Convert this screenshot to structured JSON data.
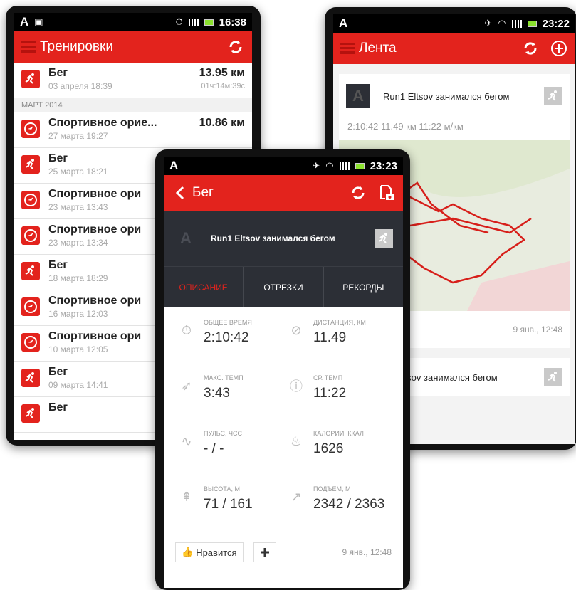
{
  "colors": {
    "accent": "#e3231d",
    "dark": "#2c2f36"
  },
  "list_phone": {
    "status": {
      "time": "16:38"
    },
    "title": "Тренировки",
    "first": {
      "title": "Бег",
      "date": "03 апреля 18:39",
      "distance": "13.95 км",
      "duration": "01ч:14м:39с"
    },
    "section": "МАРТ 2014",
    "items": [
      {
        "icon": "orienteering-icon",
        "title": "Спортивное орие...",
        "date": "27 марта 19:27",
        "distance": "10.86 км"
      },
      {
        "icon": "running-icon",
        "title": "Бег",
        "date": "25 марта 18:21"
      },
      {
        "icon": "orienteering-icon",
        "title": "Спортивное ори",
        "date": "23 марта 13:43"
      },
      {
        "icon": "orienteering-icon",
        "title": "Спортивное ори",
        "date": "23 марта 13:34"
      },
      {
        "icon": "running-icon",
        "title": "Бег",
        "date": "18 марта 18:29"
      },
      {
        "icon": "orienteering-icon",
        "title": "Спортивное ори",
        "date": "16 марта 12:03"
      },
      {
        "icon": "orienteering-icon",
        "title": "Спортивное ори",
        "date": "10 марта 12:05"
      },
      {
        "icon": "running-icon",
        "title": "Бег",
        "date": "09 марта 14:41"
      },
      {
        "icon": "running-icon",
        "title": "Бег",
        "date": ""
      }
    ]
  },
  "feed_phone": {
    "status": {
      "time": "23:22"
    },
    "title": "Лента",
    "card": {
      "avatar": "A",
      "title": "Run1 Eltsov занимался бегом",
      "stats": "2:10:42   11.49 км   11:22 м/км",
      "date": "9 янв., 12:48"
    },
    "card2_title": "Eltsov занимался бегом"
  },
  "detail_phone": {
    "status": {
      "time": "23:23"
    },
    "title": "Бег",
    "avatar": "A",
    "header": "Run1 Eltsov занимался бегом",
    "tabs": [
      "ОПИСАНИЕ",
      "ОТРЕЗКИ",
      "РЕКОРДЫ"
    ],
    "stats": [
      {
        "icon": "stopwatch-icon",
        "label": "ОБЩЕЕ ВРЕМЯ",
        "value": "2:10:42"
      },
      {
        "icon": "compass-icon",
        "label": "ДИСТАНЦИЯ, КМ",
        "value": "11.49"
      },
      {
        "icon": "rocket-icon",
        "label": "МАКС. ТЕМП",
        "value": "3:43"
      },
      {
        "icon": "gauge-icon",
        "label": "СР. ТЕМП",
        "value": "11:22"
      },
      {
        "icon": "pulse-icon",
        "label": "ПУЛЬС, ЧСС",
        "value": "- / -"
      },
      {
        "icon": "flame-icon",
        "label": "КАЛОРИИ, ККАЛ",
        "value": "1626"
      },
      {
        "icon": "altitude-icon",
        "label": "ВЫСОТА, М",
        "value": "71 / 161"
      },
      {
        "icon": "ascent-icon",
        "label": "ПОДЪЕМ, М",
        "value": "2342 / 2363"
      }
    ],
    "like_label": "Нравится",
    "date": "9 янв., 12:48"
  }
}
